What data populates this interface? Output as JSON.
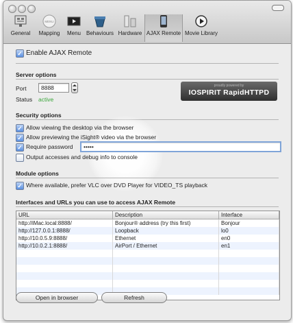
{
  "toolbar": {
    "items": [
      {
        "label": "General",
        "icon": "general-icon"
      },
      {
        "label": "Mapping",
        "icon": "mapping-icon"
      },
      {
        "label": "Menu",
        "icon": "menu-icon"
      },
      {
        "label": "Behaviours",
        "icon": "behaviours-icon"
      },
      {
        "label": "Hardware",
        "icon": "hardware-icon"
      },
      {
        "label": "AJAX Remote",
        "icon": "ajax-remote-icon",
        "selected": true
      },
      {
        "label": "Movie Library",
        "icon": "movie-library-icon"
      }
    ],
    "mapping_icon_text": "MENU"
  },
  "enable": {
    "label": "Enable AJAX Remote",
    "checked": true
  },
  "server": {
    "title": "Server options",
    "port_label": "Port",
    "port_value": "8888",
    "status_label": "Status",
    "status_value": "active",
    "status_color": "#3aa63a",
    "badge_top": "proudly powered by",
    "badge_main": "IOSPIRIT RapidHTTPD"
  },
  "security": {
    "title": "Security options",
    "options": [
      {
        "label": "Allow viewing the desktop via the browser",
        "checked": true
      },
      {
        "label": "Allow previewing the iSight® video via the browser",
        "checked": true
      },
      {
        "label": "Require password",
        "checked": true
      },
      {
        "label": "Output accesses and debug info to console",
        "checked": false
      }
    ],
    "password_value": "•••••"
  },
  "module": {
    "title": "Module options",
    "options": [
      {
        "label": "Where available, prefer VLC over DVD Player for VIDEO_TS playback",
        "checked": true
      }
    ]
  },
  "interfaces": {
    "title": "Interfaces and URLs you can use to access AJAX Remote",
    "columns": [
      "URL",
      "Description",
      "Interface"
    ],
    "rows": [
      [
        "http://iMac.local:8888/",
        "Bonjour® address (try this first)",
        "Bonjour"
      ],
      [
        "http://127.0.0.1:8888/",
        "Loopback",
        "lo0"
      ],
      [
        "http://10.0.5.9:8888/",
        "Ethernet",
        "en0"
      ],
      [
        "http://10.0.2.1:8888/",
        "AirPort / Ethernet",
        "en1"
      ],
      [
        "",
        "",
        ""
      ],
      [
        "",
        "",
        ""
      ],
      [
        "",
        "",
        ""
      ],
      [
        "",
        "",
        ""
      ],
      [
        "",
        "",
        ""
      ],
      [
        "",
        "",
        ""
      ]
    ]
  },
  "buttons": {
    "open": "Open in browser",
    "refresh": "Refresh"
  },
  "check_glyph": "✓"
}
